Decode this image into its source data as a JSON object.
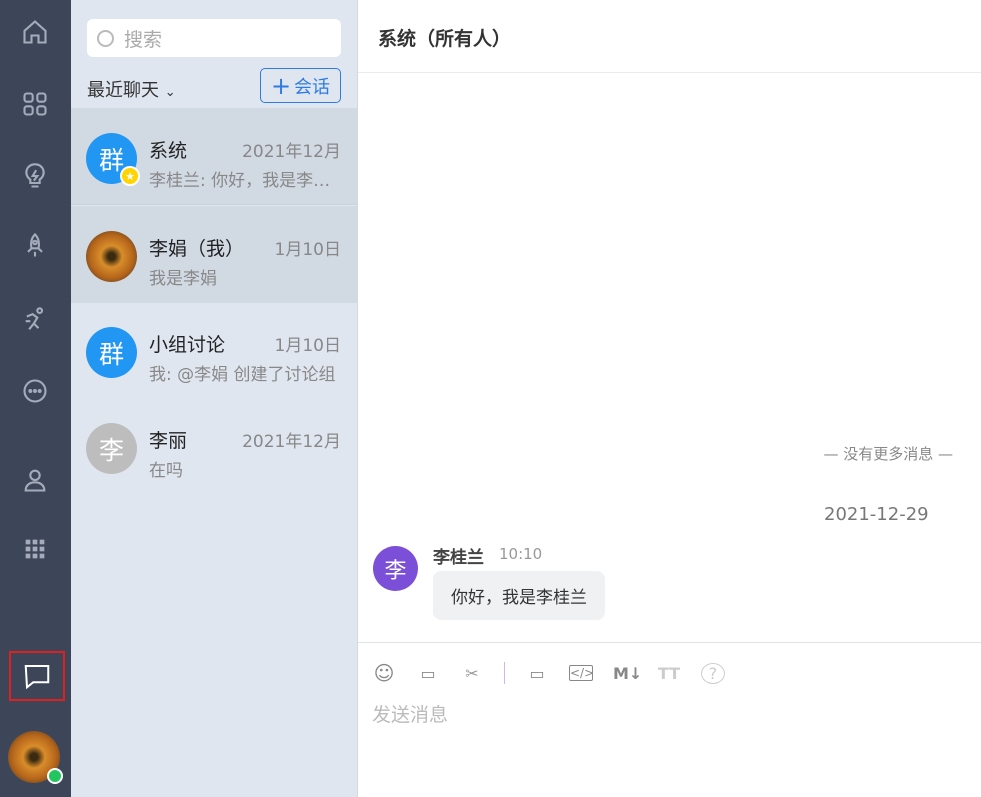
{
  "search": {
    "placeholder": "搜索"
  },
  "list": {
    "filter_label": "最近聊天",
    "new_button": "会话"
  },
  "conversations": [
    {
      "avatar": "群",
      "name": "系统",
      "time": "2021年12月",
      "preview": "李桂兰: 你好，我是李桂兰"
    },
    {
      "avatar": "",
      "name": "李娟（我）",
      "time": "1月10日",
      "preview": "我是李娟"
    },
    {
      "avatar": "群",
      "name": "小组讨论",
      "time": "1月10日",
      "preview": "我: @李娟 创建了讨论组"
    },
    {
      "avatar": "李",
      "name": "李丽",
      "time": "2021年12月",
      "preview": "在吗"
    }
  ],
  "chat": {
    "title": "系统（所有人）",
    "no_more": "— 没有更多消息 —",
    "date": "2021-12-29",
    "message": {
      "avatar": "李",
      "sender": "李桂兰",
      "time": "10:10",
      "text": "你好，我是李桂兰"
    },
    "input_placeholder": "发送消息"
  },
  "toolbar": {
    "markdown": "M↓",
    "font": "TT",
    "help": "?"
  }
}
